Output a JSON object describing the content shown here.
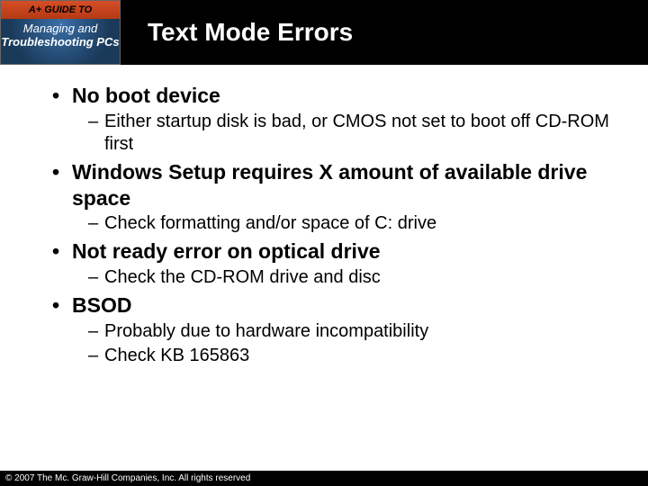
{
  "logo": {
    "top": "A+ GUIDE TO",
    "line1": "Managing",
    "line_and": "and",
    "line2": "Troubleshooting PCs"
  },
  "title": "Text Mode Errors",
  "bullets": [
    {
      "text": "No boot device",
      "subs": [
        "Either startup disk is bad, or CMOS not set to boot off CD-ROM first"
      ]
    },
    {
      "text": "Windows Setup requires X amount of available drive space",
      "subs": [
        "Check formatting and/or space of C: drive"
      ]
    },
    {
      "text": "Not ready error on optical drive",
      "subs": [
        "Check the CD-ROM drive and disc"
      ]
    },
    {
      "text": "BSOD",
      "subs": [
        "Probably due to hardware incompatibility",
        "Check KB 165863"
      ]
    }
  ],
  "footer": "© 2007 The Mc. Graw-Hill Companies, Inc. All rights reserved"
}
